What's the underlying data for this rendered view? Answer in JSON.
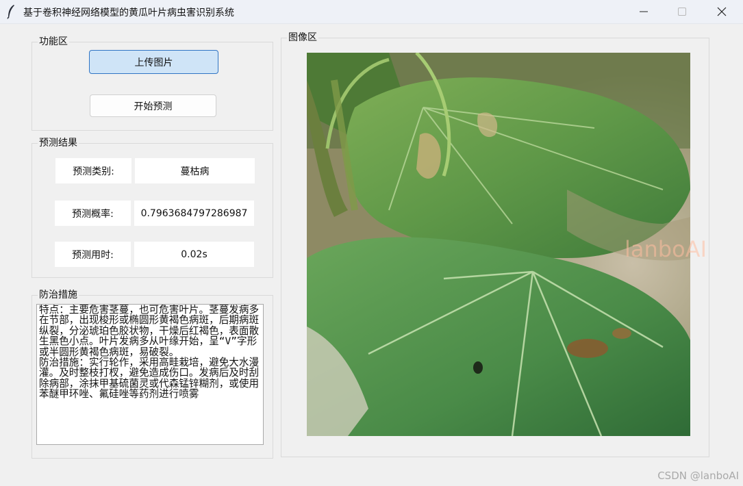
{
  "window": {
    "title": "基于卷积神经网络模型的黄瓜叶片病虫害识别系统",
    "icons": {
      "app": "feather-icon",
      "minimize": "minimize-icon",
      "maximize": "maximize-icon",
      "close": "close-icon"
    }
  },
  "function_panel": {
    "label": "功能区",
    "upload_button": "上传图片",
    "predict_button": "开始预测"
  },
  "result_panel": {
    "label": "预测结果",
    "rows": [
      {
        "label": "预测类别:",
        "value": "蔓枯病"
      },
      {
        "label": "预测概率:",
        "value": "0.7963684797286987"
      },
      {
        "label": "预测用时:",
        "value": "0.02s"
      }
    ]
  },
  "prevention_panel": {
    "label": "防治措施",
    "text": "特点：主要危害茎蔓，也可危害叶片。茎蔓发病多在节部，出现梭形或椭圆形黄褐色病斑，后期病斑纵裂，分泌琥珀色胶状物，干燥后红褐色，表面散生黑色小点。叶片发病多从叶缘开始，呈“V”字形或半圆形黄褐色病斑，易破裂。\n防治措施：实行轮作，采用高畦栽培，避免大水漫灌。及时整枝打杈，避免造成伤口。发病后及时刮除病部，涂抹甲基硫菌灵或代森锰锌糊剂，或使用苯醚甲环唑、氟硅唑等药剂进行喷雾"
  },
  "image_panel": {
    "label": "图像区",
    "image_watermark": "lanboAI"
  },
  "page_watermark": "CSDN @lanboAI"
}
